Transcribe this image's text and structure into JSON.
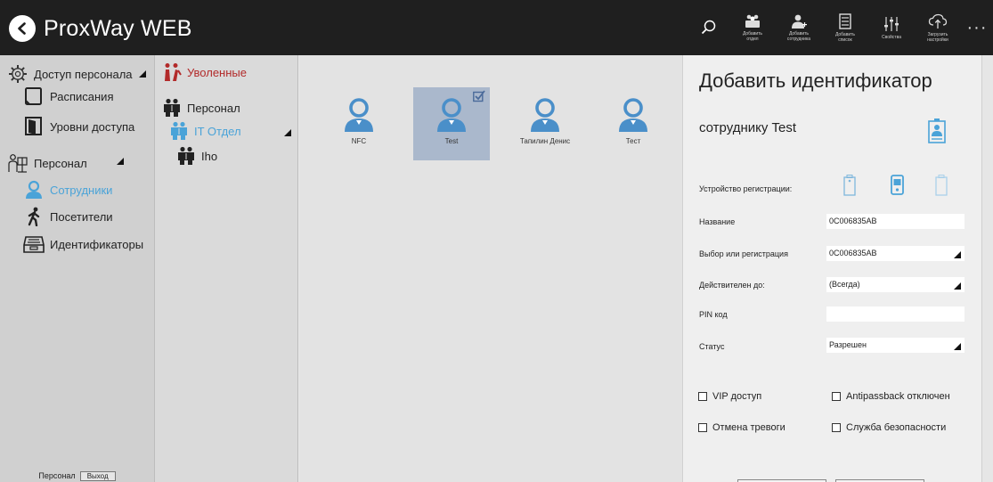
{
  "app": {
    "title": "ProxWay WEB"
  },
  "toolbar": {
    "buttons": [
      {
        "label": "Добавить\nотдел",
        "icon": "add-department-icon"
      },
      {
        "label": "Добавить\nсотрудника",
        "icon": "add-employee-icon"
      },
      {
        "label": "Добавить\nсписок",
        "icon": "add-list-icon"
      },
      {
        "label": "Свойства",
        "icon": "properties-sliders-icon"
      },
      {
        "label": "Загрузить\nнастройки",
        "icon": "cloud-upload-icon"
      }
    ],
    "more": "···"
  },
  "sidebar": {
    "items": [
      {
        "label": "Доступ персонала",
        "icon": "gear-icon"
      },
      {
        "label": "Расписания",
        "icon": "schedule-icon"
      },
      {
        "label": "Уровни доступа",
        "icon": "door-icon"
      },
      {
        "label": "Персонал",
        "icon": "personnel-icon"
      },
      {
        "label": "Сотрудники",
        "icon": "employee-icon"
      },
      {
        "label": "Посетители",
        "icon": "visitor-walking-icon"
      },
      {
        "label": "Идентификаторы",
        "icon": "card-reader-icon"
      }
    ],
    "footer": {
      "user": "Персонал",
      "exit": "Выход"
    }
  },
  "tree": {
    "items": [
      {
        "label": "Уволенные",
        "icon": "dismissed-icon"
      },
      {
        "label": "Персонал",
        "icon": "group-icon"
      },
      {
        "label": "IT Отдел",
        "icon": "group-icon"
      },
      {
        "label": "Iho",
        "icon": "group-icon"
      }
    ]
  },
  "employees": [
    {
      "name": "NFC"
    },
    {
      "name": "Test",
      "selected": true
    },
    {
      "name": "Тапилин Денис"
    },
    {
      "name": "Тест"
    }
  ],
  "panel": {
    "title": "Добавить идентификатор",
    "subtitle": "сотруднику Test",
    "device_label": "Устройство регистрации:",
    "fields": [
      {
        "label": "Название",
        "value": "0C006835AB"
      },
      {
        "label": "Выбор или регистрация",
        "value": "0C006835AB"
      },
      {
        "label": "Действителен до:",
        "value": "(Всегда)"
      },
      {
        "label": "PIN код",
        "value": ""
      },
      {
        "label": "Статус",
        "value": "Разрешен"
      }
    ],
    "checkboxes": [
      {
        "label": "VIP доступ",
        "checked": false
      },
      {
        "label": "Antipassback отключен",
        "checked": false
      },
      {
        "label": "Отмена тревоги",
        "checked": false
      },
      {
        "label": "Служба безопасности",
        "checked": false
      }
    ]
  },
  "colors": {
    "topbar": "#1f1f1f",
    "accent_blue": "#4aa3d8",
    "dismissed_red": "#b22a2a",
    "selected_tile": "#aab8cc"
  }
}
